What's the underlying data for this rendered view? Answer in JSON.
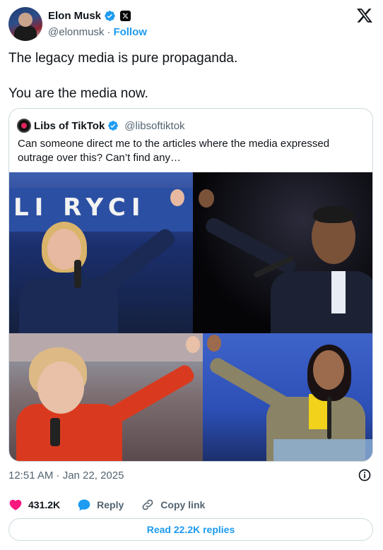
{
  "author": {
    "name": "Elon Musk",
    "handle": "@elonmusk",
    "separator": "·",
    "follow_label": "Follow"
  },
  "tweet": {
    "paragraphs": [
      "The legacy media is pure propaganda.",
      "You are the media now."
    ],
    "timestamp": "12:51 AM · Jan 22, 2025"
  },
  "quoted": {
    "name": "Libs of TikTok",
    "handle": "@libsoftiktok",
    "text": "Can someone direct me to the articles where the media expressed outrage over this? Can’t find any…",
    "image_text": "LI   RYCI"
  },
  "actions": {
    "like_count": "431.2K",
    "reply_label": "Reply",
    "copy_label": "Copy link"
  },
  "read_replies_label": "Read 22.2K replies",
  "colors": {
    "accent": "#1d9bf0",
    "like": "#f91880",
    "text": "#0f1419",
    "muted": "#536471",
    "border": "#cfd9de"
  },
  "icons": [
    "verified-badge-icon",
    "x-logo-icon",
    "info-icon",
    "heart-icon",
    "reply-icon",
    "link-icon"
  ]
}
